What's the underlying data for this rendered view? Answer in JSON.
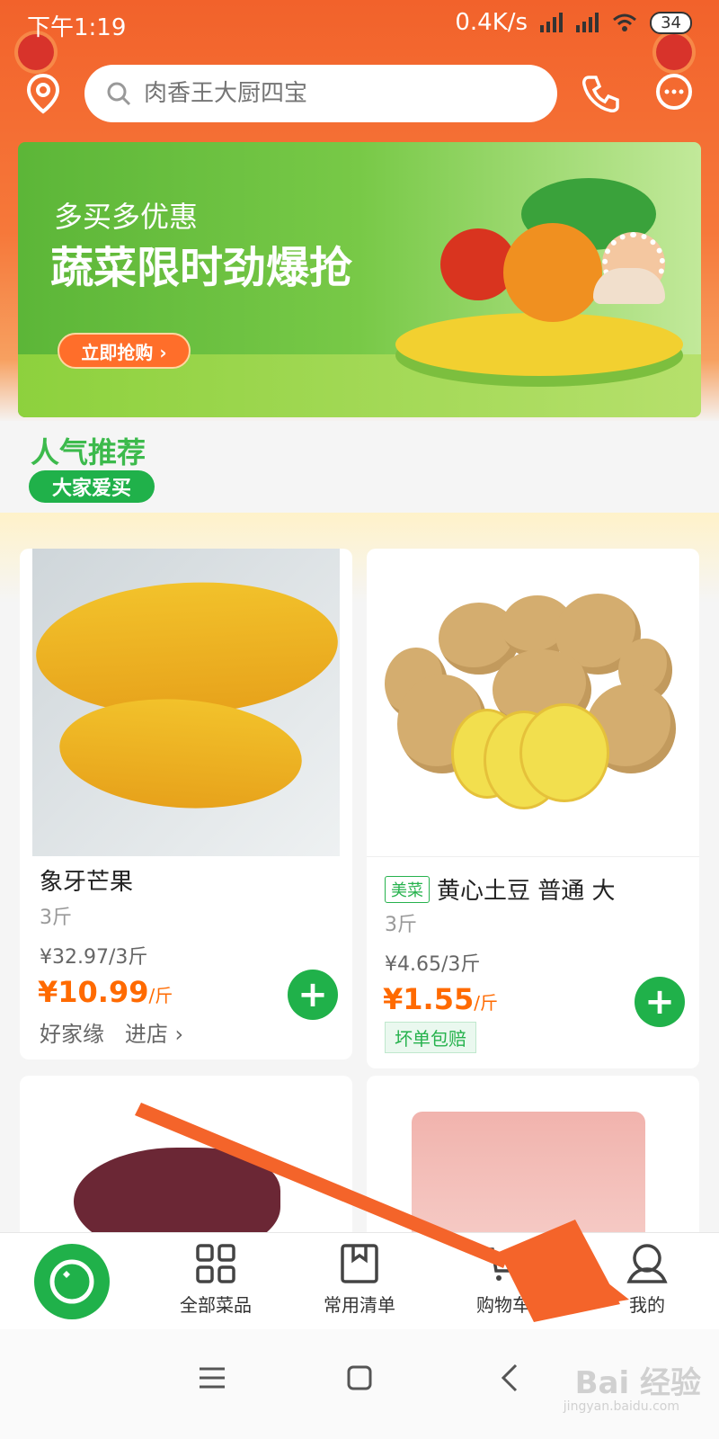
{
  "status": {
    "time": "下午1:19",
    "speed": "0.4K/s",
    "battery": "34"
  },
  "search": {
    "placeholder": "肉香王大厨四宝"
  },
  "banner": {
    "subtitle": "多买多优惠",
    "title": "蔬菜限时劲爆抢",
    "button": "立即抢购 ›"
  },
  "section": {
    "title": "人气推荐",
    "tag": "大家爱买"
  },
  "products": [
    {
      "name": "象牙芒果",
      "spec": "3斤",
      "orig_price": "¥32.97/3斤",
      "price": "¥10.99",
      "unit": "/斤",
      "shop": "好家缘",
      "shop_link": "进店 ›"
    },
    {
      "brand": "美菜",
      "name": "黄心土豆 普通 大",
      "spec": "3斤",
      "orig_price": "¥4.65/3斤",
      "price": "¥1.55",
      "unit": "/斤",
      "tag": "坏单包赔"
    }
  ],
  "tabs": [
    {
      "label": "全部菜品"
    },
    {
      "label": "常用清单"
    },
    {
      "label": "购物车"
    },
    {
      "label": "我的"
    }
  ],
  "watermark": {
    "text": "Bai 经验",
    "sub": "jingyan.baidu.com"
  },
  "colors": {
    "primary": "#20b14a",
    "accent": "#ff6a00",
    "header": "#f2622b",
    "arrow": "#f4642a"
  }
}
